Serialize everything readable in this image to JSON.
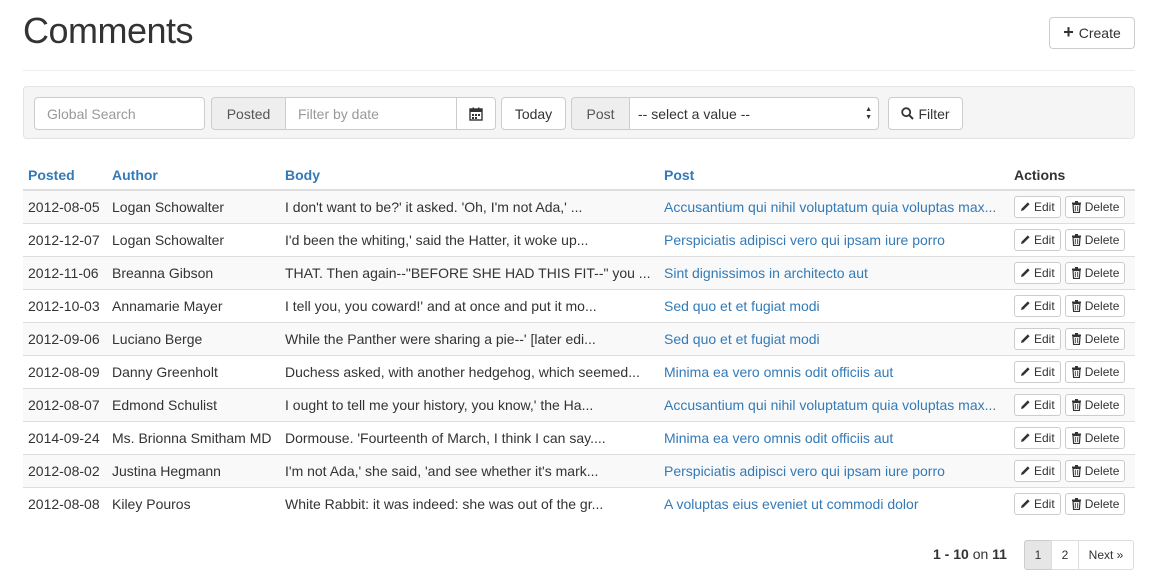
{
  "header": {
    "title": "Comments",
    "create_label": "Create"
  },
  "filters": {
    "global_search_placeholder": "Global Search",
    "posted_label": "Posted",
    "date_placeholder": "Filter by date",
    "today_label": "Today",
    "post_label": "Post",
    "post_select_value": "-- select a value --",
    "filter_label": "Filter"
  },
  "table": {
    "columns": [
      "Posted",
      "Author",
      "Body",
      "Post",
      "Actions"
    ],
    "edit_label": "Edit",
    "delete_label": "Delete",
    "rows": [
      {
        "posted": "2012-08-05",
        "author": "Logan Schowalter",
        "body": "I don't want to be?' it asked. 'Oh, I'm not Ada,' ...",
        "post": "Accusantium qui nihil voluptatum quia voluptas max..."
      },
      {
        "posted": "2012-12-07",
        "author": "Logan Schowalter",
        "body": "I'd been the whiting,' said the Hatter, it woke up...",
        "post": "Perspiciatis adipisci vero qui ipsam iure porro"
      },
      {
        "posted": "2012-11-06",
        "author": "Breanna Gibson",
        "body": "THAT. Then again--\"BEFORE SHE HAD THIS FIT--\" you ...",
        "post": "Sint dignissimos in architecto aut"
      },
      {
        "posted": "2012-10-03",
        "author": "Annamarie Mayer",
        "body": "I tell you, you coward!' and at once and put it mo...",
        "post": "Sed quo et et fugiat modi"
      },
      {
        "posted": "2012-09-06",
        "author": "Luciano Berge",
        "body": "While the Panther were sharing a pie--' [later edi...",
        "post": "Sed quo et et fugiat modi"
      },
      {
        "posted": "2012-08-09",
        "author": "Danny Greenholt",
        "body": "Duchess asked, with another hedgehog, which seemed...",
        "post": "Minima ea vero omnis odit officiis aut"
      },
      {
        "posted": "2012-08-07",
        "author": "Edmond Schulist",
        "body": "I ought to tell me your history, you know,' the Ha...",
        "post": "Accusantium qui nihil voluptatum quia voluptas max..."
      },
      {
        "posted": "2014-09-24",
        "author": "Ms. Brionna Smitham MD",
        "body": "Dormouse. 'Fourteenth of March, I think I can say....",
        "post": "Minima ea vero omnis odit officiis aut"
      },
      {
        "posted": "2012-08-02",
        "author": "Justina Hegmann",
        "body": "I'm not Ada,' she said, 'and see whether it's mark...",
        "post": "Perspiciatis adipisci vero qui ipsam iure porro"
      },
      {
        "posted": "2012-08-08",
        "author": "Kiley Pouros",
        "body": "White Rabbit: it was indeed: she was out of the gr...",
        "post": "A voluptas eius eveniet ut commodi dolor"
      }
    ]
  },
  "pagination": {
    "range": "1 - 10",
    "on": "on",
    "total": "11",
    "pages": [
      "1",
      "2"
    ],
    "next_label": "Next »",
    "current": 1
  },
  "icons": {
    "create": "plus-icon",
    "calendar": "calendar-icon",
    "filter": "search-icon",
    "edit": "pencil-icon",
    "delete": "trash-icon"
  },
  "colors": {
    "link": "#337ab7",
    "border": "#dddddd",
    "stripe": "#f9f9f9"
  }
}
